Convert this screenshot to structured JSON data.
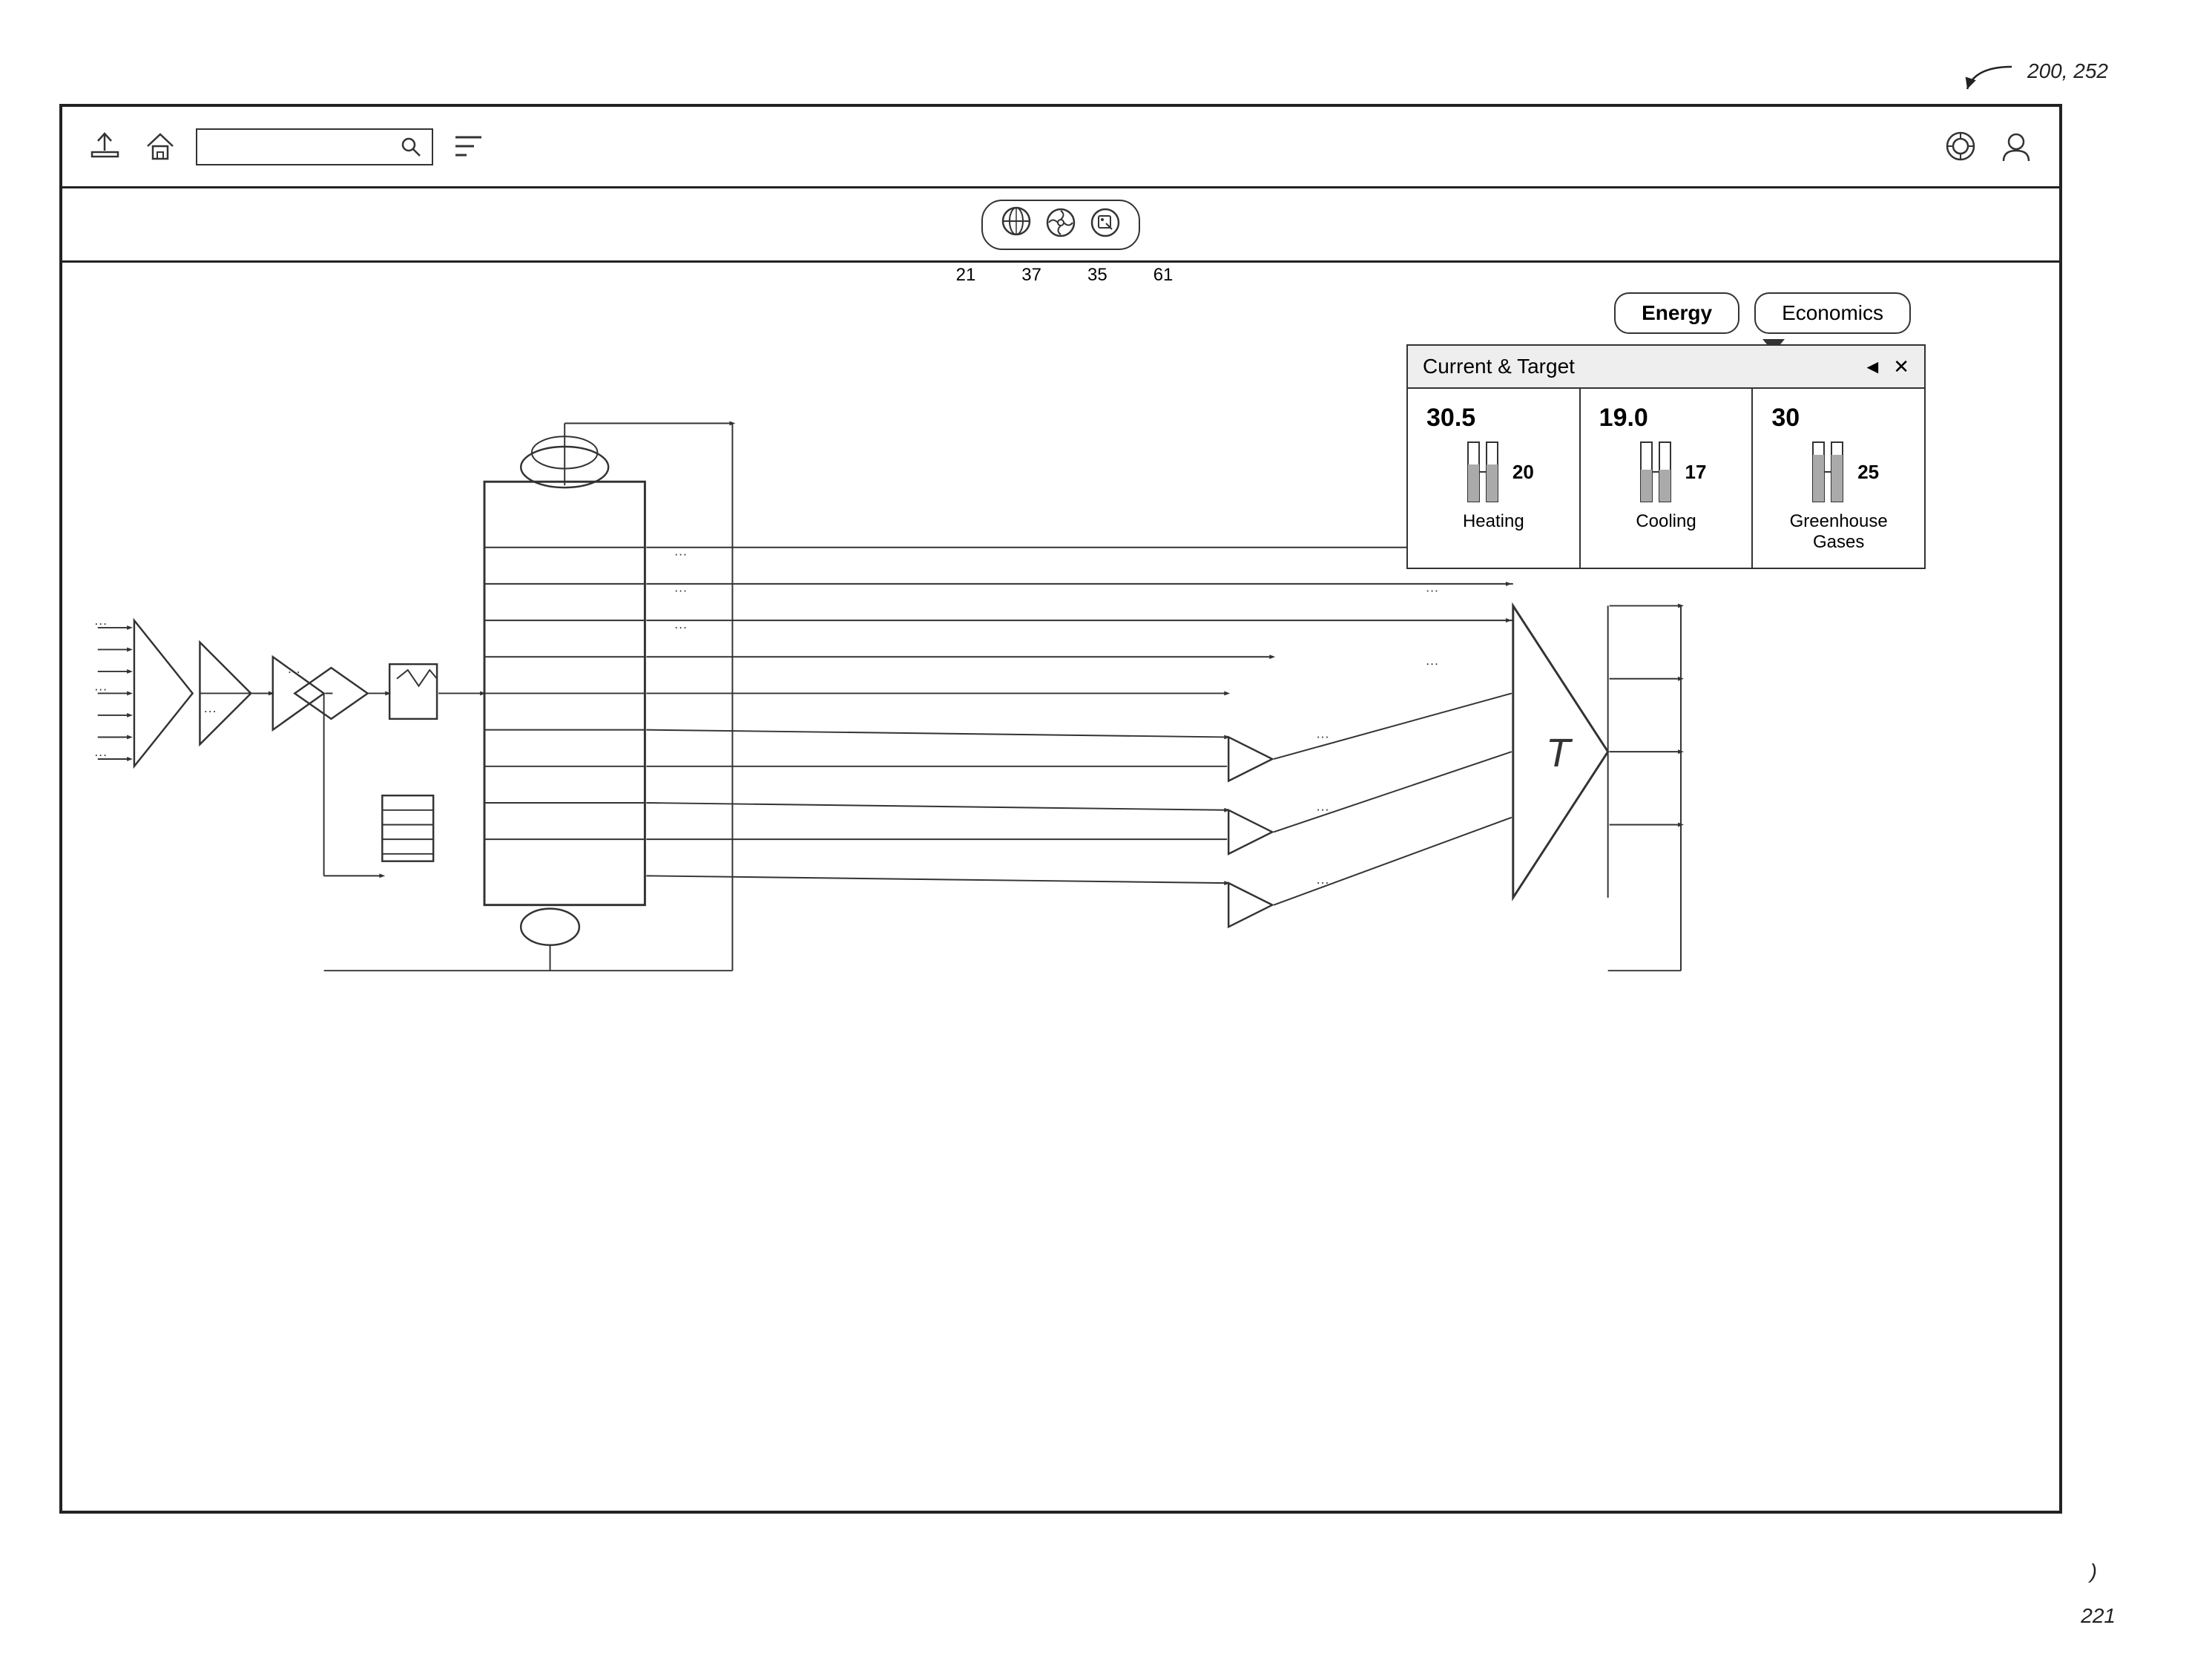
{
  "reference": {
    "top_label": "200, 252",
    "bottom_label": "221",
    "arrow_label": ")"
  },
  "toolbar": {
    "upload_icon": "⬆",
    "home_icon": "⌂",
    "search_placeholder": "",
    "search_icon": "🔍",
    "filter_icon": "≡",
    "settings_icon": "◎",
    "user_icon": "👤"
  },
  "icon_strip": {
    "icons": [
      "🌐",
      "🌀",
      "🏷"
    ],
    "labels": [
      "21",
      "37",
      "35",
      "61"
    ]
  },
  "tabs": {
    "energy_label": "Energy",
    "economics_label": "Economics"
  },
  "panel": {
    "title": "Current & Target",
    "back_icon": "◄",
    "close_icon": "✕",
    "cells": [
      {
        "big_value": "30.5",
        "small_value": "20",
        "label": "Heating",
        "fill_pct": 65
      },
      {
        "big_value": "19.0",
        "small_value": "17",
        "label": "Cooling",
        "fill_pct": 55
      },
      {
        "big_value": "30",
        "small_value": "25",
        "label": "Greenhouse\nGases",
        "fill_pct": 80
      }
    ]
  }
}
